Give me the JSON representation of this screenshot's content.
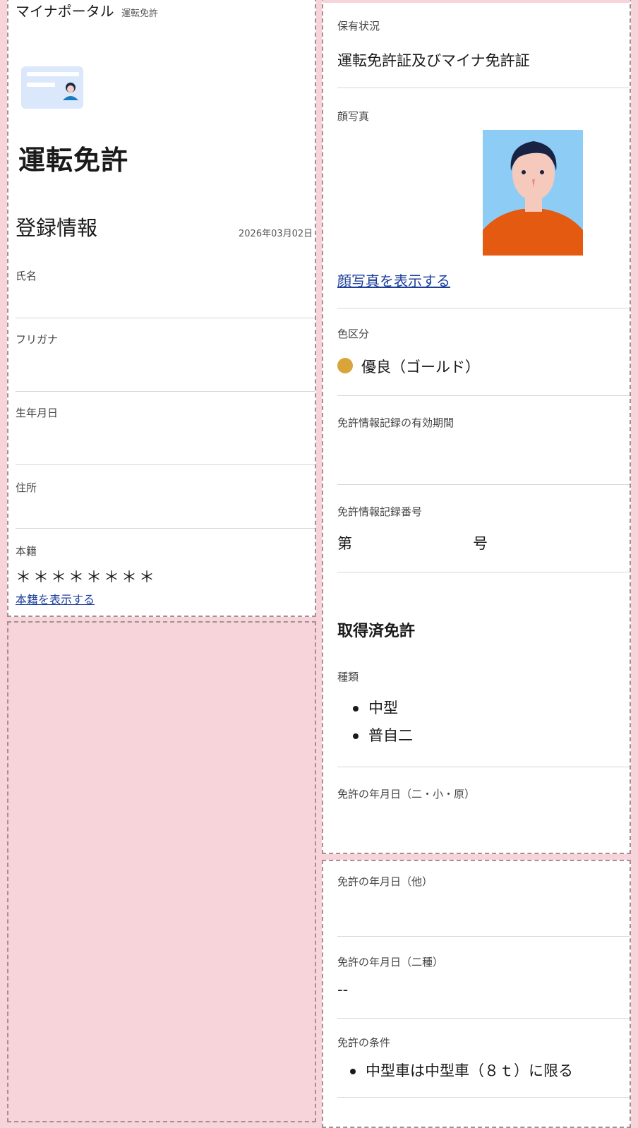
{
  "header": {
    "app_title": "マイナポータル",
    "page_crumb": "運転免許"
  },
  "page_title": "運転免許",
  "registration": {
    "heading": "登録情報",
    "date": "2026年03月02日",
    "fields": {
      "name_label": "氏名",
      "furigana_label": "フリガナ",
      "birthdate_label": "生年月日",
      "address_label": "住所",
      "honseki_label": "本籍",
      "honseki_value": "＊＊＊＊＊＊＊＊",
      "honseki_link": "本籍を表示する"
    }
  },
  "license": {
    "status_label": "保有状況",
    "status_value": "運転免許証及びマイナ免許証",
    "photo_label": "顔写真",
    "photo_link": "顔写真を表示する",
    "color_label": "色区分",
    "color_value": "優良（ゴールド）",
    "color_dot": "#d9a53a",
    "validity_label": "免許情報記録の有効期間",
    "number_label": "免許情報記録番号",
    "number_prefix": "第",
    "number_suffix": "号",
    "acquired_heading": "取得済免許",
    "types_label": "種類",
    "types": [
      "中型",
      "普自二"
    ],
    "date_2small_label": "免許の年月日（二・小・原）",
    "date_other_label": "免許の年月日（他）",
    "date_second_label": "免許の年月日（二種）",
    "date_second_value": "--",
    "conditions_label": "免許の条件",
    "conditions": [
      "中型車は中型車（８ｔ）に限る"
    ]
  },
  "colors": {
    "link": "#1b3f9a",
    "background": "#f7d3da",
    "portrait_bg": "#8dcdf5",
    "portrait_shirt": "#e35a10"
  }
}
